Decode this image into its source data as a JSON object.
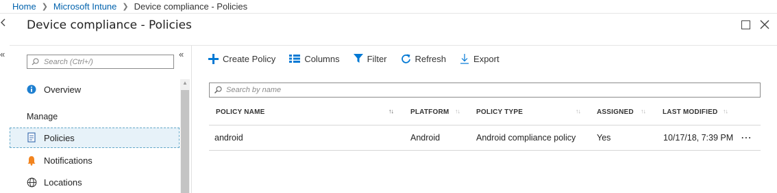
{
  "breadcrumb": {
    "items": [
      "Home",
      "Microsoft Intune"
    ],
    "current": "Device compliance - Policies"
  },
  "blade": {
    "title": "Device compliance - Policies"
  },
  "menu": {
    "search_placeholder": "Search (Ctrl+/)",
    "overview": "Overview",
    "section_manage": "Manage",
    "items": [
      {
        "label": "Policies",
        "icon": "document-icon",
        "selected": true
      },
      {
        "label": "Notifications",
        "icon": "bell-icon"
      },
      {
        "label": "Locations",
        "icon": "globe-icon"
      }
    ]
  },
  "toolbar": {
    "create": "Create Policy",
    "columns": "Columns",
    "filter": "Filter",
    "refresh": "Refresh",
    "export": "Export"
  },
  "grid": {
    "search_placeholder": "Search by name",
    "columns": [
      "POLICY NAME",
      "PLATFORM",
      "POLICY TYPE",
      "ASSIGNED",
      "LAST MODIFIED"
    ],
    "rows": [
      {
        "name": "android",
        "platform": "Android",
        "type": "Android compliance policy",
        "assigned": "Yes",
        "modified": "10/17/18, 7:39 PM"
      }
    ]
  },
  "colors": {
    "accent": "#0078d4",
    "link": "#0062ad",
    "selected_bg": "#e7f2f9"
  }
}
